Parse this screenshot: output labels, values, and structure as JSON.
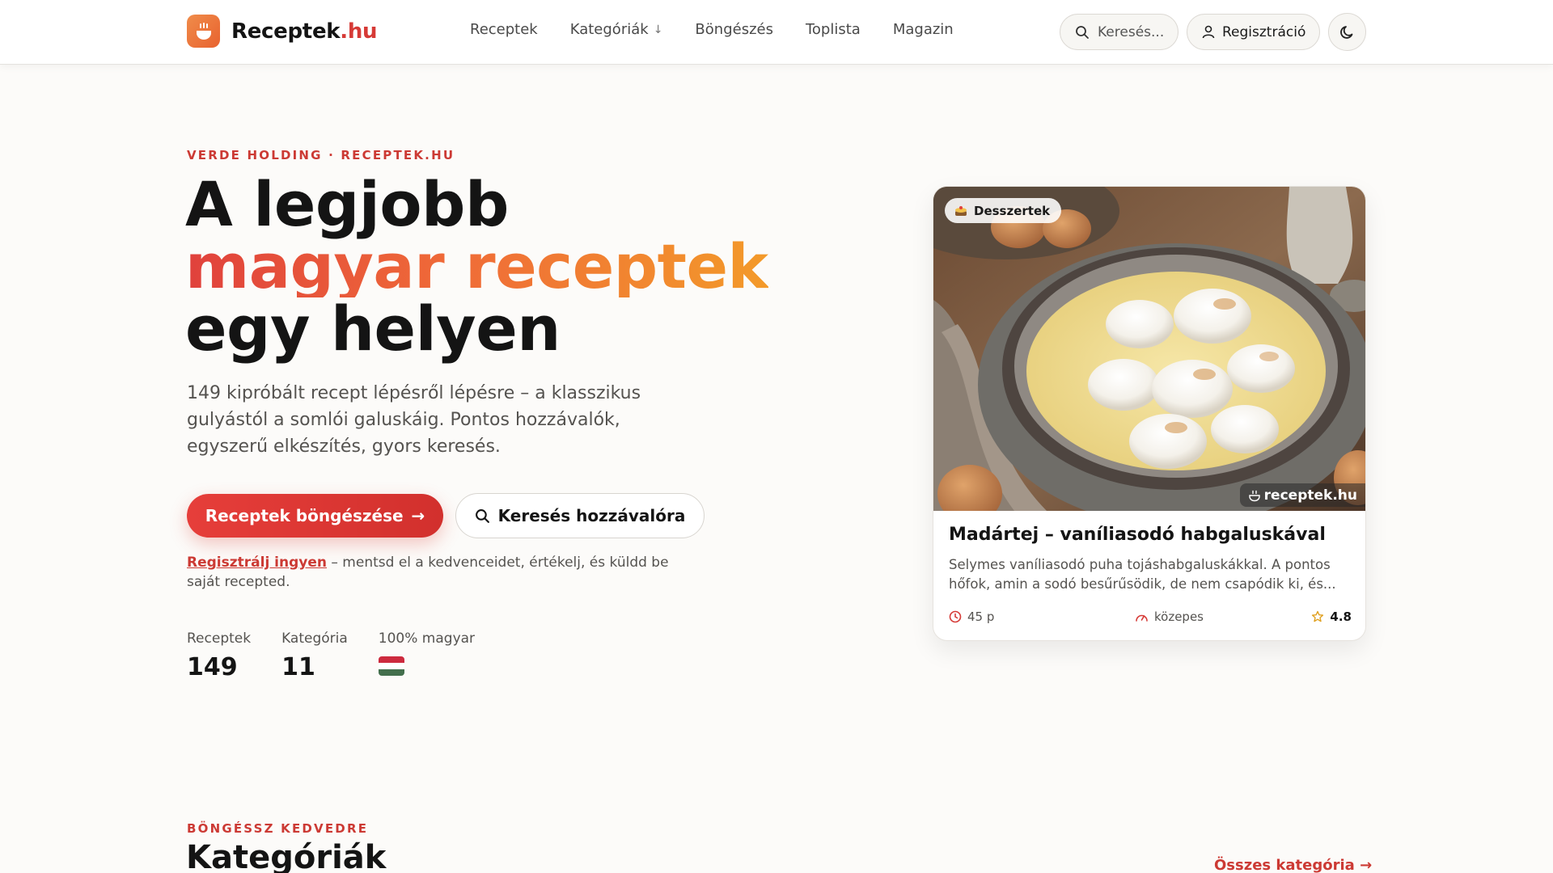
{
  "header": {
    "logo_main": "Receptek",
    "logo_accent": ".hu",
    "nav": [
      {
        "label": "Receptek"
      },
      {
        "label": "Kategóriák",
        "has_dropdown": true
      },
      {
        "label": "Böngészés"
      },
      {
        "label": "Toplista"
      },
      {
        "label": "Magazin"
      }
    ],
    "search_placeholder": "Keresés...",
    "register_label": "Regisztráció"
  },
  "hero": {
    "eyebrow": "VERDE HOLDING · RECEPTEK.HU",
    "headline_line1": "A legjobb",
    "headline_line2": "magyar receptek",
    "headline_line3": "egy helyen",
    "lede": "149 kipróbált recept lépésről lépésre – a klasszikus gulyástól a somlói galuskáig. Pontos hozzávalók, egyszerű elkészítés, gyors keresés.",
    "primary_button": "Receptek böngészése",
    "secondary_button": "Keresés hozzávalóra",
    "signup_link": "Regisztrálj ingyen",
    "signup_rest": " – mentsd el a kedvenceidet, értékelj, és küldd be saját recepted.",
    "stats": [
      {
        "label": "Receptek",
        "value": "149"
      },
      {
        "label": "Kategória",
        "value": "11"
      },
      {
        "label": "100% magyar",
        "value": ""
      }
    ],
    "flag_colors": [
      "#cd2a3e",
      "#ffffff",
      "#436f4d"
    ]
  },
  "featured_card": {
    "category": "Desszertek",
    "watermark": "receptek.hu",
    "title": "Madártej – vaníliasodó habgaluskával",
    "description": "Selymes vaníliasodó puha tojáshabgaluskákkal. A pontos hőfok, amin a sodó besűrűsödik, de nem csapódik ki, és...",
    "time": "45 p",
    "difficulty": "közepes",
    "rating": "4.8"
  },
  "categories_section": {
    "eyebrow": "BÖNGÉSSZ KEDVEDRE",
    "title": "Kategóriák",
    "all_link": "Összes kategória"
  },
  "colors": {
    "brand_red": "#cc3a34",
    "brand_orange": "#f39a2a",
    "background": "#fcfbf9"
  }
}
